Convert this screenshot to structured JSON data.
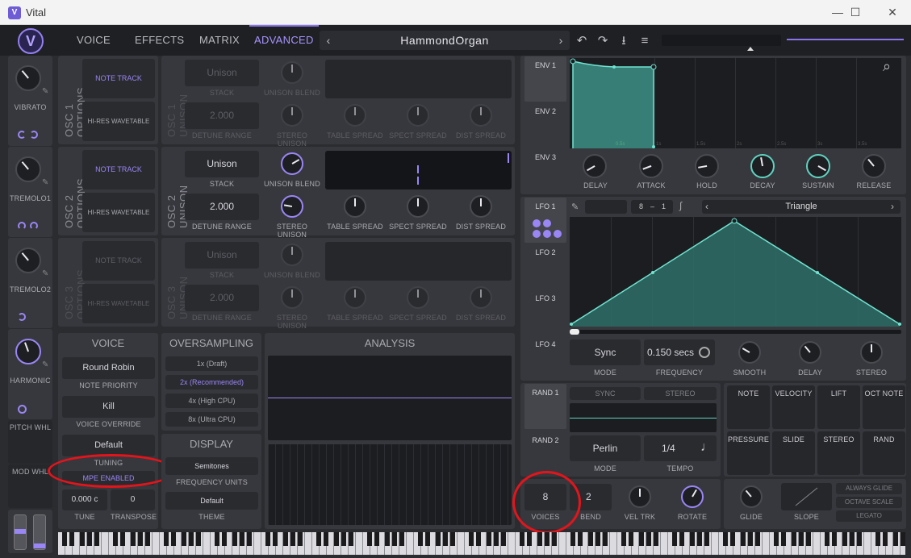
{
  "window": {
    "title": "Vital",
    "minimize": "—",
    "maximize": "☐",
    "close": "✕"
  },
  "app": {
    "logo": "V"
  },
  "tabs": [
    {
      "label": "VOICE"
    },
    {
      "label": "EFFECTS"
    },
    {
      "label": "MATRIX"
    },
    {
      "label": "ADVANCED"
    }
  ],
  "preset": {
    "name": "HammondOrgan",
    "prev": "‹",
    "next": "›"
  },
  "toolbar": {
    "undo": "↶",
    "redo": "↷",
    "save": "⭳",
    "menu": "≡"
  },
  "left_mods": {
    "vibrato": "VIBRATO",
    "tremolo1": "TREMOLO1",
    "tremolo2": "TREMOLO2",
    "harmonic": "HARMONIC",
    "pitch_wheel": "PITCH WHL",
    "mod_wheel": "MOD WHL"
  },
  "osc_options": {
    "osc1": "OSC 1 OPTIONS",
    "osc2": "OSC 2 OPTIONS",
    "osc3": "OSC 3 OPTIONS",
    "note_track": "NOTE TRACK",
    "hi_res": "HI-RES WAVETABLE"
  },
  "unison": {
    "osc1": "OSC 1 UNISON",
    "osc2": "OSC 2 UNISON",
    "osc3": "OSC 3 UNISON",
    "stack_value": "Unison",
    "stack_label": "STACK",
    "unison_blend": "UNISON BLEND",
    "detune_value": "2.000",
    "detune_label": "DETUNE RANGE",
    "stereo_unison": "STEREO UNISON",
    "table_spread": "TABLE SPREAD",
    "spect_spread": "SPECT SPREAD",
    "dist_spread": "DIST SPREAD"
  },
  "voice": {
    "title": "VOICE",
    "priority_value": "Round Robin",
    "priority_label": "NOTE PRIORITY",
    "override_value": "Kill",
    "override_label": "VOICE OVERRIDE",
    "tuning_value": "Default",
    "tuning_label": "TUNING",
    "mpe": "MPE ENABLED",
    "tune_value": "0.000 c",
    "tune_label": "TUNE",
    "transpose_value": "0",
    "transpose_label": "TRANSPOSE"
  },
  "oversampling": {
    "title": "OVERSAMPLING",
    "options": [
      "1x (Draft)",
      "2x (Recommended)",
      "4x (High CPU)",
      "8x (Ultra CPU)"
    ],
    "selected": "2x (Recommended)"
  },
  "display": {
    "title": "DISPLAY",
    "units_value": "Semitones",
    "units_label": "FREQUENCY UNITS",
    "theme_value": "Default",
    "theme_label": "THEME"
  },
  "analysis": {
    "title": "ANALYSIS"
  },
  "env": {
    "tabs": [
      "ENV 1",
      "ENV 2",
      "ENV 3"
    ],
    "knobs": [
      "DELAY",
      "ATTACK",
      "HOLD",
      "DECAY",
      "SUSTAIN",
      "RELEASE"
    ],
    "time_labels": [
      "0.5s",
      "1s",
      "1.5s",
      "2s",
      "2.5s",
      "3s",
      "3.5s"
    ]
  },
  "lfo": {
    "tabs": [
      "LFO 1",
      "LFO 2",
      "LFO 3",
      "LFO 4"
    ],
    "grid_x": "8",
    "grid_sep": "–",
    "grid_y": "1",
    "shape": "Triangle",
    "mode_value": "Sync",
    "mode_label": "MODE",
    "freq_value": "0.150 secs",
    "freq_label": "FREQUENCY",
    "smooth": "SMOOTH",
    "delay": "DELAY",
    "stereo": "STEREO"
  },
  "random": {
    "tabs": [
      "RAND 1",
      "RAND 2"
    ],
    "sync": "SYNC",
    "stereo": "STEREO",
    "mode_value": "Perlin",
    "mode_label": "MODE",
    "tempo_value": "1/4",
    "tempo_label": "TEMPO"
  },
  "mod_sources": [
    "NOTE",
    "VELOCITY",
    "LIFT",
    "OCT NOTE",
    "PRESSURE",
    "SLIDE",
    "STEREO",
    "RAND"
  ],
  "bottom": {
    "voices_value": "8",
    "voices_label": "VOICES",
    "bend_value": "2",
    "bend_label": "BEND",
    "vel_trk": "VEL TRK",
    "rotate": "ROTATE",
    "glide": "GLIDE",
    "slope": "SLOPE",
    "always_glide": "ALWAYS GLIDE",
    "octave_scale": "OCTAVE SCALE",
    "legato": "LEGATO"
  },
  "icons": {
    "search": "⌕"
  }
}
